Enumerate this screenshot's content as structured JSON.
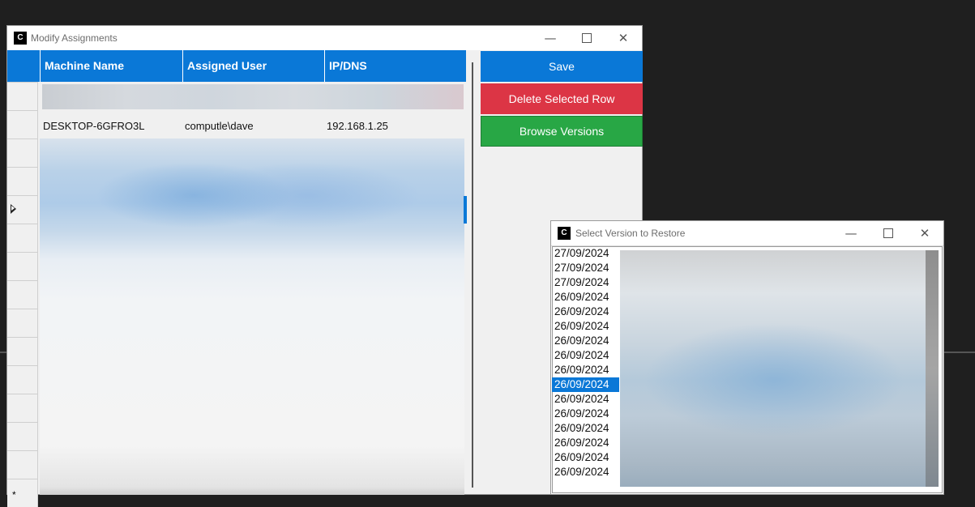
{
  "modify_window": {
    "icon_letter": "C",
    "title": "Modify Assignments",
    "controls": {
      "minimize": "—",
      "close": "✕"
    },
    "columns": [
      "Machine Name",
      "Assigned User",
      "IP/DNS"
    ],
    "rows": [
      {
        "machine": "DESKTOP-6GFRO3L",
        "user": "computle\\dave",
        "ip": "192.168.1.25"
      }
    ],
    "buttons": {
      "save": "Save",
      "delete": "Delete Selected Row",
      "browse": "Browse Versions"
    },
    "colors": {
      "save": "#0a78d7",
      "delete": "#dc3545",
      "browse": "#28a745",
      "header": "#0a78d7"
    },
    "new_row_marker": "*"
  },
  "version_window": {
    "icon_letter": "C",
    "title": "Select Version to Restore",
    "controls": {
      "minimize": "—",
      "close": "✕"
    },
    "versions": [
      "27/09/2024",
      "27/09/2024",
      "27/09/2024",
      "26/09/2024",
      "26/09/2024",
      "26/09/2024",
      "26/09/2024",
      "26/09/2024",
      "26/09/2024",
      "26/09/2024",
      "26/09/2024",
      "26/09/2024",
      "26/09/2024",
      "26/09/2024",
      "26/09/2024",
      "26/09/2024"
    ],
    "selected_index": 9
  }
}
